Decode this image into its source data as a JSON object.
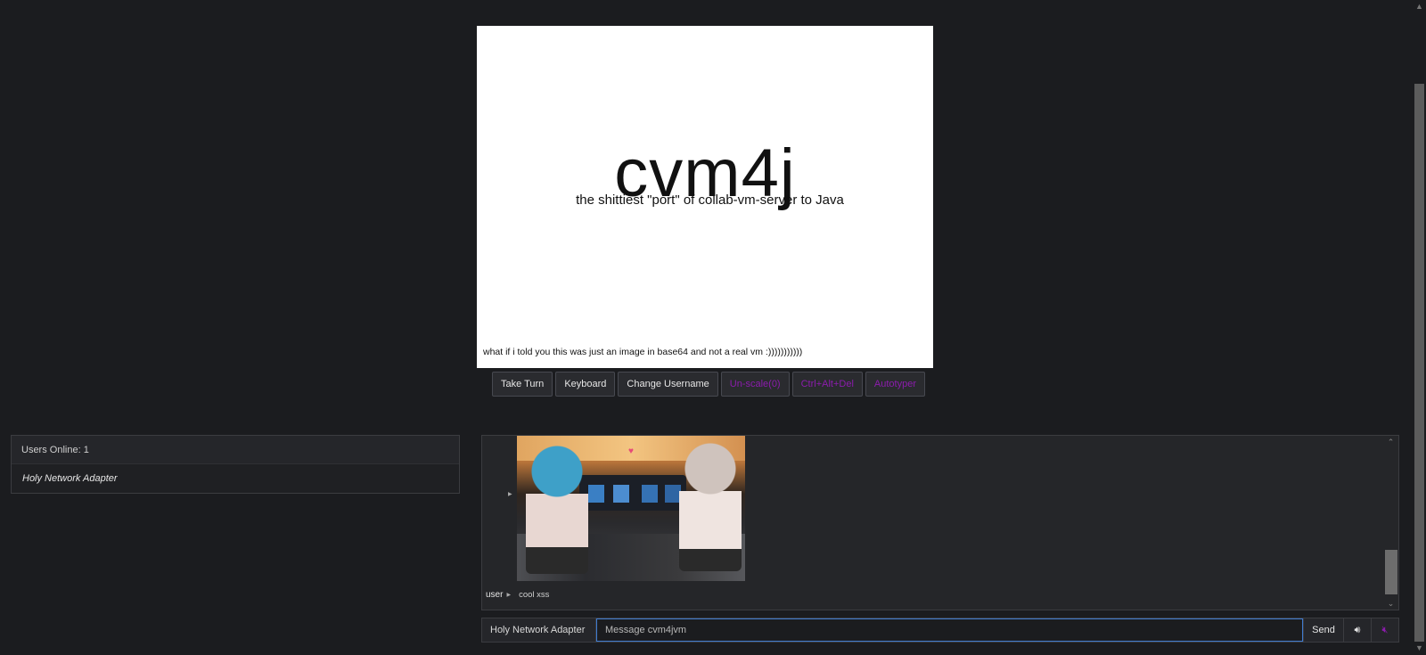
{
  "vm": {
    "title": "cvm4j",
    "subtitle": "the shittiest \"port\" of collab-vm-server to Java",
    "footer": "what if i told you this was just an image in base64 and not a real vm :)))))))))))"
  },
  "toolbar": {
    "take_turn": "Take Turn",
    "keyboard": "Keyboard",
    "change_username": "Change Username",
    "unscale": "Un-scale(0)",
    "ctrl_alt_del": "Ctrl+Alt+Del",
    "autotyper": "Autotyper"
  },
  "users": {
    "header": "Users Online: 1",
    "list": [
      "Holy Network Adapter"
    ]
  },
  "chat": {
    "messages": [
      {
        "user": "user",
        "text": "cool xss"
      }
    ],
    "username": "Holy Network Adapter",
    "placeholder": "Message cvm4jvm",
    "input_value": "",
    "send_label": "Send",
    "volume_icon": "speaker-icon",
    "mute_icon": "mute-icon"
  },
  "colors": {
    "background": "#1b1c1f",
    "disabled_text": "#8c1cad",
    "focus_border": "#3f7bd0"
  }
}
